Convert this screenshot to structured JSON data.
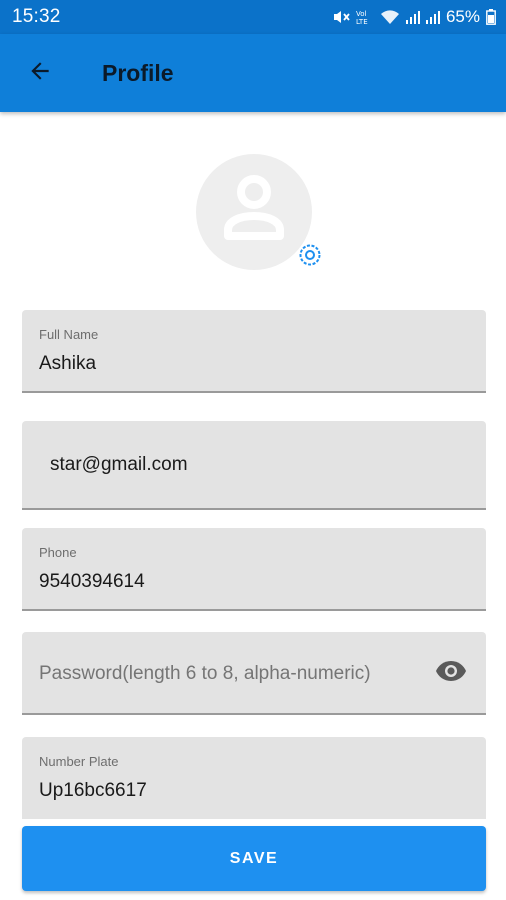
{
  "status_bar": {
    "time": "15:32",
    "battery": "65%",
    "icons": [
      "mute-icon",
      "volte-icon",
      "wifi-icon",
      "signal-icon",
      "signal-icon",
      "battery-icon"
    ]
  },
  "app_bar": {
    "title": "Profile",
    "back_icon": "arrow-left-icon"
  },
  "avatar": {
    "icon": "person-placeholder-icon",
    "camera_icon": "camera-icon"
  },
  "form": {
    "full_name": {
      "label": "Full Name",
      "value": "Ashika"
    },
    "email": {
      "value": "star@gmail.com"
    },
    "phone": {
      "label": "Phone",
      "value": "9540394614"
    },
    "password": {
      "placeholder": "Password(length 6 to 8, alpha-numeric)",
      "toggle_icon": "eye-icon"
    },
    "number_plate": {
      "label": "Number Plate",
      "value": "Up16bc6617"
    }
  },
  "actions": {
    "save_label": "SAVE"
  },
  "colors": {
    "status_bar": "#0b72c9",
    "app_bar": "#0f7fd9",
    "save_button": "#1e90f0",
    "field_bg": "#e3e3e3"
  }
}
